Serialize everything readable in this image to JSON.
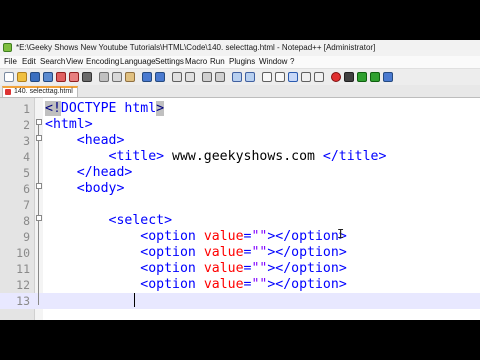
{
  "window": {
    "title": "*E:\\Geeky Shows New Youtube Tutorials\\HTML\\Code\\140. selecttag.html - Notepad++ [Administrator]"
  },
  "menu": [
    "File",
    "Edit",
    "Search",
    "View",
    "Encoding",
    "Language",
    "Settings",
    "Macro",
    "Run",
    "Plugins",
    "Window",
    "?"
  ],
  "tab": {
    "label": "140. selecttag.html"
  },
  "editor": {
    "line_numbers": [
      "1",
      "2",
      "3",
      "4",
      "5",
      "6",
      "7",
      "8",
      "9",
      "10",
      "11",
      "12",
      "13"
    ],
    "lines": [
      {
        "segments": [
          [
            "dt",
            "<!"
          ],
          [
            "t",
            "DOCTYPE html"
          ],
          [
            "dt",
            ">"
          ]
        ]
      },
      {
        "segments": [
          [
            "t",
            "<html>"
          ]
        ]
      },
      {
        "segments": [
          [
            "txt",
            "    "
          ],
          [
            "t",
            "<head>"
          ]
        ]
      },
      {
        "segments": [
          [
            "txt",
            "        "
          ],
          [
            "t",
            "<title>"
          ],
          [
            "txt",
            " www.geekyshows.com "
          ],
          [
            "t",
            "</title>"
          ]
        ]
      },
      {
        "segments": [
          [
            "txt",
            "    "
          ],
          [
            "t",
            "</head>"
          ]
        ]
      },
      {
        "segments": [
          [
            "txt",
            "    "
          ],
          [
            "t",
            "<body>"
          ]
        ]
      },
      {
        "segments": []
      },
      {
        "segments": [
          [
            "txt",
            "        "
          ],
          [
            "t",
            "<select>"
          ]
        ]
      },
      {
        "segments": [
          [
            "txt",
            "            "
          ],
          [
            "t",
            "<option "
          ],
          [
            "a",
            "value"
          ],
          [
            "t",
            "="
          ],
          [
            "v",
            "\"\""
          ],
          [
            "t",
            "></option>"
          ]
        ]
      },
      {
        "segments": [
          [
            "txt",
            "            "
          ],
          [
            "t",
            "<option "
          ],
          [
            "a",
            "value"
          ],
          [
            "t",
            "="
          ],
          [
            "v",
            "\"\""
          ],
          [
            "t",
            "></option>"
          ]
        ]
      },
      {
        "segments": [
          [
            "txt",
            "            "
          ],
          [
            "t",
            "<option "
          ],
          [
            "a",
            "value"
          ],
          [
            "t",
            "="
          ],
          [
            "v",
            "\"\""
          ],
          [
            "t",
            "></option>"
          ]
        ]
      },
      {
        "segments": [
          [
            "txt",
            "            "
          ],
          [
            "t",
            "<option "
          ],
          [
            "a",
            "value"
          ],
          [
            "t",
            "="
          ],
          [
            "v",
            "\"\""
          ],
          [
            "t",
            "></option>"
          ]
        ]
      },
      {
        "segments": [
          [
            "txt",
            "            "
          ]
        ]
      }
    ],
    "current_line": 13
  },
  "colors": {
    "tag": "#0000ff",
    "attribute": "#ff0000",
    "value": "#8000ff",
    "text": "#000000",
    "current_line": "#e8e8ff",
    "tab_accent": "#f2a23a"
  }
}
